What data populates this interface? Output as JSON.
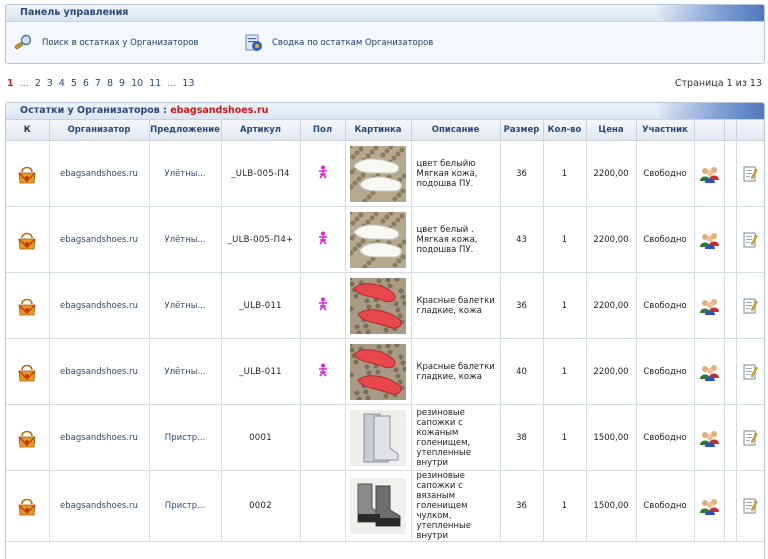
{
  "panel": {
    "title": "Панель управления",
    "links": [
      {
        "label": "Поиск в остатках у Организаторов",
        "icon": "magnifier-icon"
      },
      {
        "label": "Сводка по остаткам Организаторов",
        "icon": "report-icon"
      }
    ]
  },
  "pagination": {
    "current": "1",
    "first_dots": "...",
    "pages": [
      "2",
      "3",
      "4",
      "5",
      "6",
      "7",
      "8",
      "9",
      "10",
      "11"
    ],
    "last_dots": "...",
    "last": "13",
    "info": "Страница 1 из 13"
  },
  "table": {
    "title_prefix": "Остатки у Организаторов : ",
    "title_name": "ebagsandshoes.ru",
    "columns": [
      "К",
      "Организатор",
      "Предложение",
      "Артикул",
      "Пол",
      "Картинка",
      "Описание",
      "Размер",
      "Кол-во",
      "Цена",
      "Участник",
      "",
      "",
      ""
    ],
    "rows": [
      {
        "organizer": "ebagsandshoes.ru",
        "offer": "Улётны...",
        "article": "_ULB-005-П4",
        "gender": "female",
        "description": "цвет белыйю Мягкая кожа, подошва ПУ.",
        "size": "36",
        "qty": "1",
        "price": "2200,00",
        "participant": "Свободно",
        "pic": "white-flats"
      },
      {
        "organizer": "ebagsandshoes.ru",
        "offer": "Улётны...",
        "article": "_ULB-005-П4+",
        "gender": "female",
        "description": "цвет белый . Мягкая кожа, подошва ПУ.",
        "size": "43",
        "qty": "1",
        "price": "2200,00",
        "participant": "Свободно",
        "pic": "white-flats"
      },
      {
        "organizer": "ebagsandshoes.ru",
        "offer": "Улётны...",
        "article": "_ULB-011",
        "gender": "female",
        "description": "Красные балетки гладкие, кожа",
        "size": "36",
        "qty": "1",
        "price": "2200,00",
        "participant": "Свободно",
        "pic": "red-flats"
      },
      {
        "organizer": "ebagsandshoes.ru",
        "offer": "Улётны...",
        "article": "_ULB-011",
        "gender": "female",
        "description": "Красные балетки гладкие, кожа",
        "size": "40",
        "qty": "1",
        "price": "2200,00",
        "participant": "Свободно",
        "pic": "red-flats"
      },
      {
        "organizer": "ebagsandshoes.ru",
        "offer": "Пристр...",
        "article": "0001",
        "gender": "",
        "description": "резиновые сапожки с кожаным голенищем, утепленные внутри",
        "size": "38",
        "qty": "1",
        "price": "1500,00",
        "participant": "Свободно",
        "pic": "grey-boots"
      },
      {
        "organizer": "ebagsandshoes.ru",
        "offer": "Пристр...",
        "article": "0002",
        "gender": "",
        "description": "резиновые сапожки с вязаным голенищем чулком, утепленные внутри",
        "size": "36",
        "qty": "1",
        "price": "1500,00",
        "participant": "Свободно",
        "pic": "knit-boots"
      }
    ]
  },
  "colors": {
    "accent": "#2b4a78",
    "red": "#cc1a1a",
    "border": "#b7c6d8",
    "female": "#e020e0"
  }
}
